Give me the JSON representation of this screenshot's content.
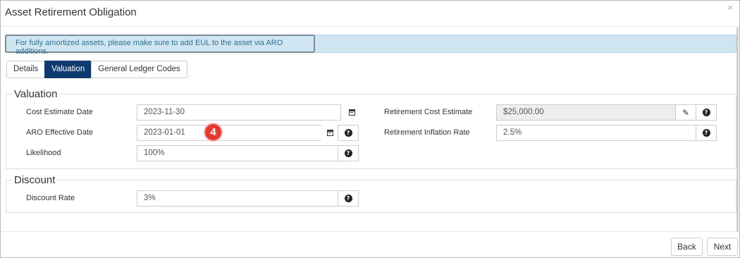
{
  "dialog": {
    "title": "Asset Retirement Obligation",
    "close_glyph": "×"
  },
  "alert": {
    "text": "For fully amortized assets, please make sure to add EUL to the asset via ARO additions."
  },
  "tabs": [
    {
      "label": "Details",
      "active": false
    },
    {
      "label": "Valuation",
      "active": true
    },
    {
      "label": "General Ledger Codes",
      "active": false
    }
  ],
  "valuation": {
    "legend": "Valuation",
    "cost_estimate_date": {
      "label": "Cost Estimate Date",
      "value": "2023-11-30"
    },
    "aro_effective_date": {
      "label": "ARO Effective Date",
      "value": "2023-01-01"
    },
    "likelihood": {
      "label": "Likelihood",
      "value": "100%"
    },
    "retirement_cost_estimate": {
      "label": "Retirement Cost Estimate",
      "value": "$25,000.00"
    },
    "retirement_inflation_rate": {
      "label": "Retirement Inflation Rate",
      "value": "2.5%"
    }
  },
  "discount": {
    "legend": "Discount",
    "discount_rate": {
      "label": "Discount Rate",
      "value": "3%"
    }
  },
  "step_badge": "4",
  "footer": {
    "back_label": "Back",
    "next_label": "Next"
  },
  "colors": {
    "active_tab": "#0f3a6f",
    "alert_bg": "#cfe6f2",
    "badge": "#e53935"
  },
  "icons": {
    "calendar": "calendar-icon",
    "help": "question-circle-icon",
    "edit": "pencil-icon",
    "close": "close-icon"
  }
}
